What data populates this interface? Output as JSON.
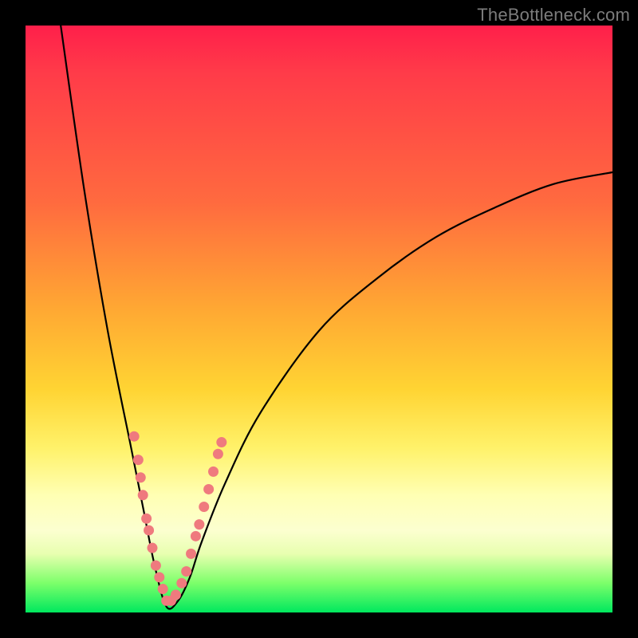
{
  "watermark": "TheBottleneck.com",
  "colors": {
    "frame": "#000000",
    "gradient_top": "#ff1f4a",
    "gradient_mid": "#ffd433",
    "gradient_bottom": "#00e85e",
    "curve": "#000000",
    "dots": "#ef7a7e"
  },
  "chart_data": {
    "type": "line",
    "title": "",
    "xlabel": "",
    "ylabel": "",
    "xlim": [
      0,
      100
    ],
    "ylim": [
      0,
      100
    ],
    "grid": false,
    "legend": false,
    "description": "Bottleneck-style V-curve. Y is percentage-like (0 at bottom = best / green, 100 at top = worst / red). X is an unlabeled parameter axis. Curve has a sharp minimum near x≈24 reaching y≈0, rises steeply toward y≈100 at x≈6 on the left, and rises with diminishing slope to y≈75 at x=100 on the right.",
    "series": [
      {
        "name": "bottleneck-curve",
        "x": [
          6,
          10,
          14,
          18,
          20,
          22,
          24,
          26,
          28,
          30,
          34,
          40,
          50,
          60,
          70,
          80,
          90,
          100
        ],
        "y": [
          100,
          72,
          48,
          28,
          18,
          8,
          1,
          2,
          6,
          12,
          22,
          34,
          48,
          57,
          64,
          69,
          73,
          75
        ]
      }
    ],
    "highlight_points": {
      "name": "sample-dots",
      "note": "Pink dots clustered on both flanks of the minimum, roughly y in [5,30]; two denser dashed-looking runs.",
      "points": [
        {
          "x": 18.5,
          "y": 30
        },
        {
          "x": 19.2,
          "y": 26
        },
        {
          "x": 19.6,
          "y": 23
        },
        {
          "x": 20.0,
          "y": 20
        },
        {
          "x": 20.6,
          "y": 16
        },
        {
          "x": 21.0,
          "y": 14
        },
        {
          "x": 21.6,
          "y": 11
        },
        {
          "x": 22.2,
          "y": 8
        },
        {
          "x": 22.8,
          "y": 6
        },
        {
          "x": 23.4,
          "y": 4
        },
        {
          "x": 24.0,
          "y": 2
        },
        {
          "x": 24.8,
          "y": 2
        },
        {
          "x": 25.6,
          "y": 3
        },
        {
          "x": 26.6,
          "y": 5
        },
        {
          "x": 27.4,
          "y": 7
        },
        {
          "x": 28.2,
          "y": 10
        },
        {
          "x": 29.0,
          "y": 13
        },
        {
          "x": 29.6,
          "y": 15
        },
        {
          "x": 30.4,
          "y": 18
        },
        {
          "x": 31.2,
          "y": 21
        },
        {
          "x": 32.0,
          "y": 24
        },
        {
          "x": 32.8,
          "y": 27
        },
        {
          "x": 33.4,
          "y": 29
        }
      ]
    }
  }
}
